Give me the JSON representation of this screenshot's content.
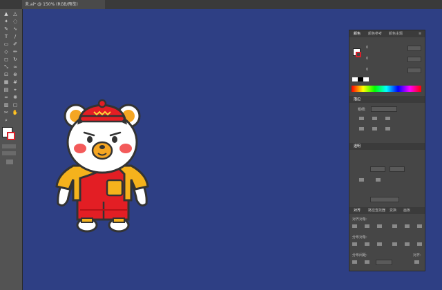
{
  "document_tab": {
    "title": "未.ai* @ 150% (RGB/预览)"
  },
  "toolbar": {
    "tools": [
      "selection-tool",
      "direct-selection-tool",
      "magic-wand-tool",
      "lasso-tool",
      "pen-tool",
      "curvature-tool",
      "type-tool",
      "line-tool",
      "rectangle-tool",
      "paintbrush-tool",
      "shaper-tool",
      "pencil-tool",
      "eraser-tool",
      "rotate-tool",
      "scale-tool",
      "width-tool",
      "free-transform-tool",
      "shape-builder-tool",
      "perspective-grid-tool",
      "mesh-tool",
      "gradient-tool",
      "eyedropper-tool",
      "blend-tool",
      "symbol-sprayer-tool",
      "column-graph-tool",
      "artboard-tool",
      "slice-tool",
      "hand-tool",
      "zoom-tool"
    ],
    "colors": {
      "fill": "#ffffff",
      "stroke": "#d9202a"
    }
  },
  "color_panel": {
    "tabs": [
      "颜色",
      "颜色参考",
      "颜色主题"
    ],
    "channel_values": [
      "0",
      "0",
      "0"
    ]
  },
  "stroke_panel": {
    "tab": "描边",
    "weight_label": "粗细:"
  },
  "transparency_panel": {
    "tab": "透明"
  },
  "align_panel": {
    "tabs": [
      "对齐",
      "路径查找器",
      "变换",
      "画板"
    ],
    "align_objects_label": "对齐对象:",
    "distribute_objects_label": "分布对象:",
    "distribute_spacing_label": "分布间距:",
    "align_to_label": "对齐:"
  },
  "canvas": {
    "background": "#2e3f84"
  }
}
